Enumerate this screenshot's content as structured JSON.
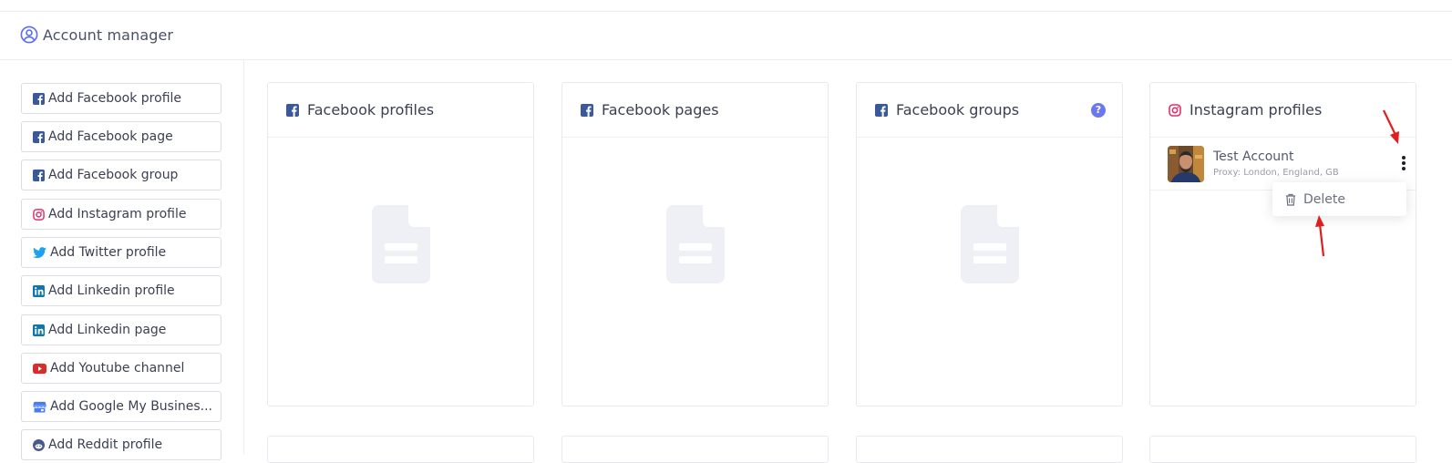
{
  "header": {
    "title": "Account manager",
    "icon": "user-circle-icon"
  },
  "sidebar": {
    "buttons": [
      {
        "label": "Add Facebook profile",
        "icon": "facebook-icon",
        "color": "#3b5998"
      },
      {
        "label": "Add Facebook page",
        "icon": "facebook-icon",
        "color": "#3b5998"
      },
      {
        "label": "Add Facebook group",
        "icon": "facebook-icon",
        "color": "#3b5998"
      },
      {
        "label": "Add Instagram profile",
        "icon": "instagram-icon",
        "color": "#e1306c"
      },
      {
        "label": "Add Twitter profile",
        "icon": "twitter-icon",
        "color": "#1da1f2"
      },
      {
        "label": "Add Linkedin profile",
        "icon": "linkedin-icon",
        "color": "#0e76a8"
      },
      {
        "label": "Add Linkedin page",
        "icon": "linkedin-icon",
        "color": "#0e76a8"
      },
      {
        "label": "Add Youtube channel",
        "icon": "youtube-icon",
        "color": "#d32f2f"
      },
      {
        "label": "Add Google My Busines...",
        "icon": "store-icon",
        "color": "#4a7cf0"
      },
      {
        "label": "Add Reddit profile",
        "icon": "reddit-icon",
        "color": "#4a5a8a"
      }
    ]
  },
  "cards": [
    {
      "title": "Facebook profiles",
      "icon": "facebook-icon"
    },
    {
      "title": "Facebook pages",
      "icon": "facebook-icon"
    },
    {
      "title": "Facebook groups",
      "icon": "facebook-icon",
      "help": "?"
    },
    {
      "title": "Instagram profiles",
      "icon": "instagram-icon"
    }
  ],
  "instagram_account": {
    "name": "Test Account",
    "proxy": "Proxy: London, England, GB"
  },
  "menu": {
    "delete_label": "Delete",
    "icon": "trash-icon"
  },
  "colors": {
    "accent": "#6a78f0",
    "facebook": "#3b5998",
    "instagram": "#e1306c",
    "annotation": "#e01e1e"
  }
}
